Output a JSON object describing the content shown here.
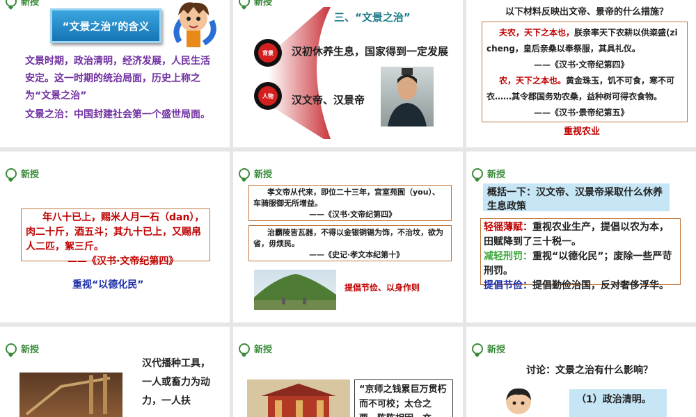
{
  "common": {
    "header_label": "新授"
  },
  "s1": {
    "title": "“文景之治”的含义",
    "para1": "文景时期，政治清明，经济发展，人民生活安定。这一时期的统治局面，历史上称之为“文景之治”",
    "para2": "文景之治：中国封建社会第一个盛世局面。"
  },
  "s2": {
    "title": "三、“文景之治”",
    "badge1": "背景",
    "text1": "汉初休养生息，国家得到一定发展",
    "badge2": "人物",
    "text2": "汉文帝、汉景帝"
  },
  "s3": {
    "question": "以下材料反映出文帝、景帝的什么措施？",
    "q1_red": "夫农，天下之本也，",
    "q1_rest": "朕亲率天下农耕以供粢盛(zi cheng，皇后亲桑以奉祭服，其具礼仪。",
    "src1": "——《汉书·文帝纪第四》",
    "q2_red": "农，天下之本也。",
    "q2_rest": "黄金珠玉，饥不可食，寒不可衣……其令郡国务劝农桑，益种树可得衣食物。",
    "src2": "——《汉书·景帝纪第五》",
    "answer": "重视农业"
  },
  "s4": {
    "quote": "年八十已上，赐米人月一石（dan），肉二十斤，酒五斗；其九十已上，又赐帛人二匹，絮三斤。",
    "src": "——《汉书·文帝纪第四》",
    "answer": "重视“以德化民”"
  },
  "s5": {
    "q1": "孝文帝从代来，即位二十三年，宫室苑囿（you）、车骑服御无所增益。",
    "src1": "——《汉书·文帝纪第四》",
    "q2": "治霸陵皆瓦器，不得以金银铜锡为饰，不治坟，欲为省，毋烦民。",
    "src2": "——《史记·孝文本纪第十》",
    "answer": "提倡节俭、以身作则"
  },
  "s6": {
    "title": "概括一下：汉文帝、汉景帝采取什么休养生息政策",
    "i1_label": "轻徭薄赋：",
    "i1_text": "重视农业生产，提倡以农为本，田赋降到了三十税一。",
    "i2_label": "减轻刑罚：",
    "i2_text": "重视“以德化民”；废除一些严苛刑罚。",
    "i3_label": "提倡节俭：",
    "i3_text": "提倡勤俭治国，反对奢侈浮华。"
  },
  "s7": {
    "text": "汉代播种工具，一人或畜力为动力，一人扶"
  },
  "s8": {
    "quote": "“京师之钱累巨万贯朽而不可校；太仓之粟，陈陈相因，充"
  },
  "s9": {
    "question": "讨论：文景之治有什么影响？",
    "point1": "（1）政治清明。"
  },
  "colors": {
    "green": "#3a8a3a",
    "purple": "#7030a0",
    "red": "#c00000",
    "blue": "#1c2fa8",
    "title_box": "#1e8bc9"
  }
}
